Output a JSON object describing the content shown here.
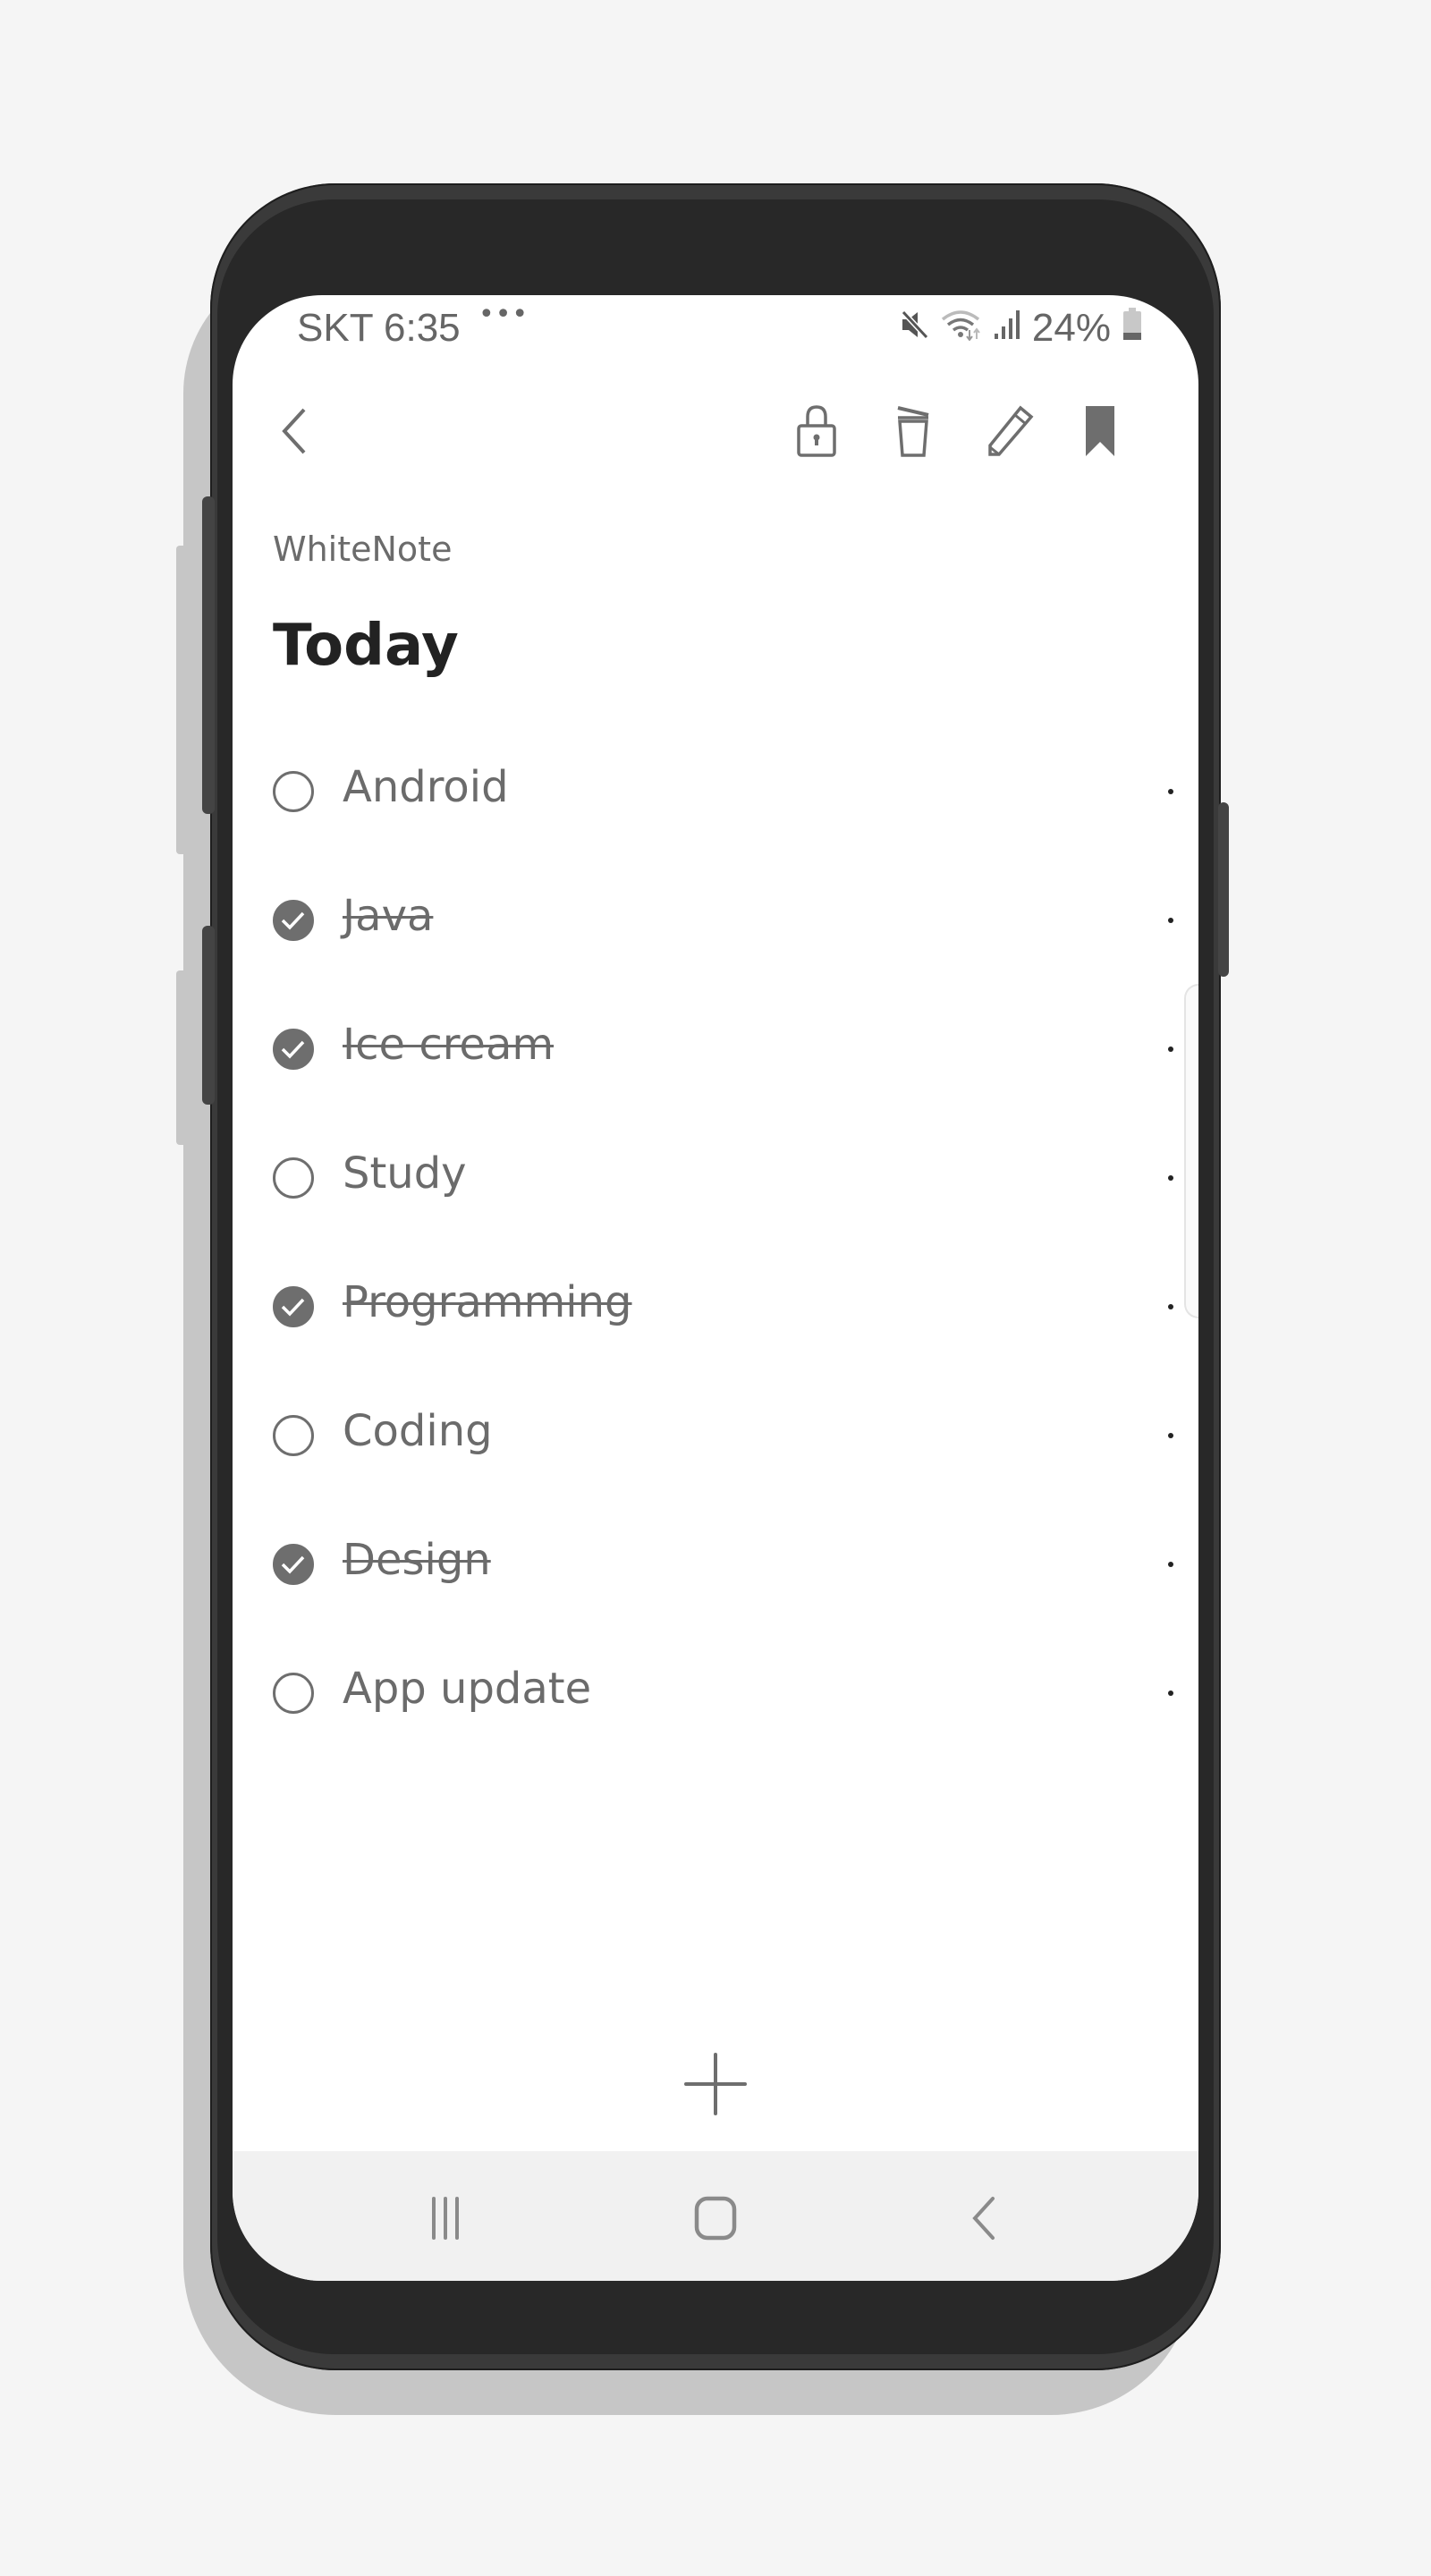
{
  "status_bar": {
    "carrier_time": "SKT 6:35",
    "more_indicator": "•••",
    "icons": [
      "mute-icon",
      "wifi-icon",
      "signal-icon"
    ],
    "battery_percent": "24%",
    "battery_level": 0.24
  },
  "toolbar": {
    "back_icon": "chevron-left-icon",
    "actions": [
      "lock-icon",
      "trash-icon",
      "pencil-icon",
      "bookmark-icon"
    ]
  },
  "note": {
    "app_label": "WhiteNote",
    "title": "Today"
  },
  "checklist": {
    "items": [
      {
        "label": "Android",
        "done": false
      },
      {
        "label": "Java",
        "done": true
      },
      {
        "label": "Ice cream",
        "done": true
      },
      {
        "label": "Study",
        "done": false
      },
      {
        "label": "Programming",
        "done": true
      },
      {
        "label": "Coding",
        "done": false
      },
      {
        "label": "Design",
        "done": true
      },
      {
        "label": "App update",
        "done": false
      }
    ]
  },
  "add_button_icon": "plus-icon",
  "nav_bar": {
    "buttons": [
      "recents-icon",
      "home-icon",
      "back-icon"
    ]
  },
  "colors": {
    "icon_gray": "#6e6e6e",
    "text_gray": "#6b6b6b",
    "title": "#222222",
    "phone_body": "#282828",
    "nav_bar_bg": "#f1f1f1",
    "page_bg": "#f5f5f5"
  }
}
